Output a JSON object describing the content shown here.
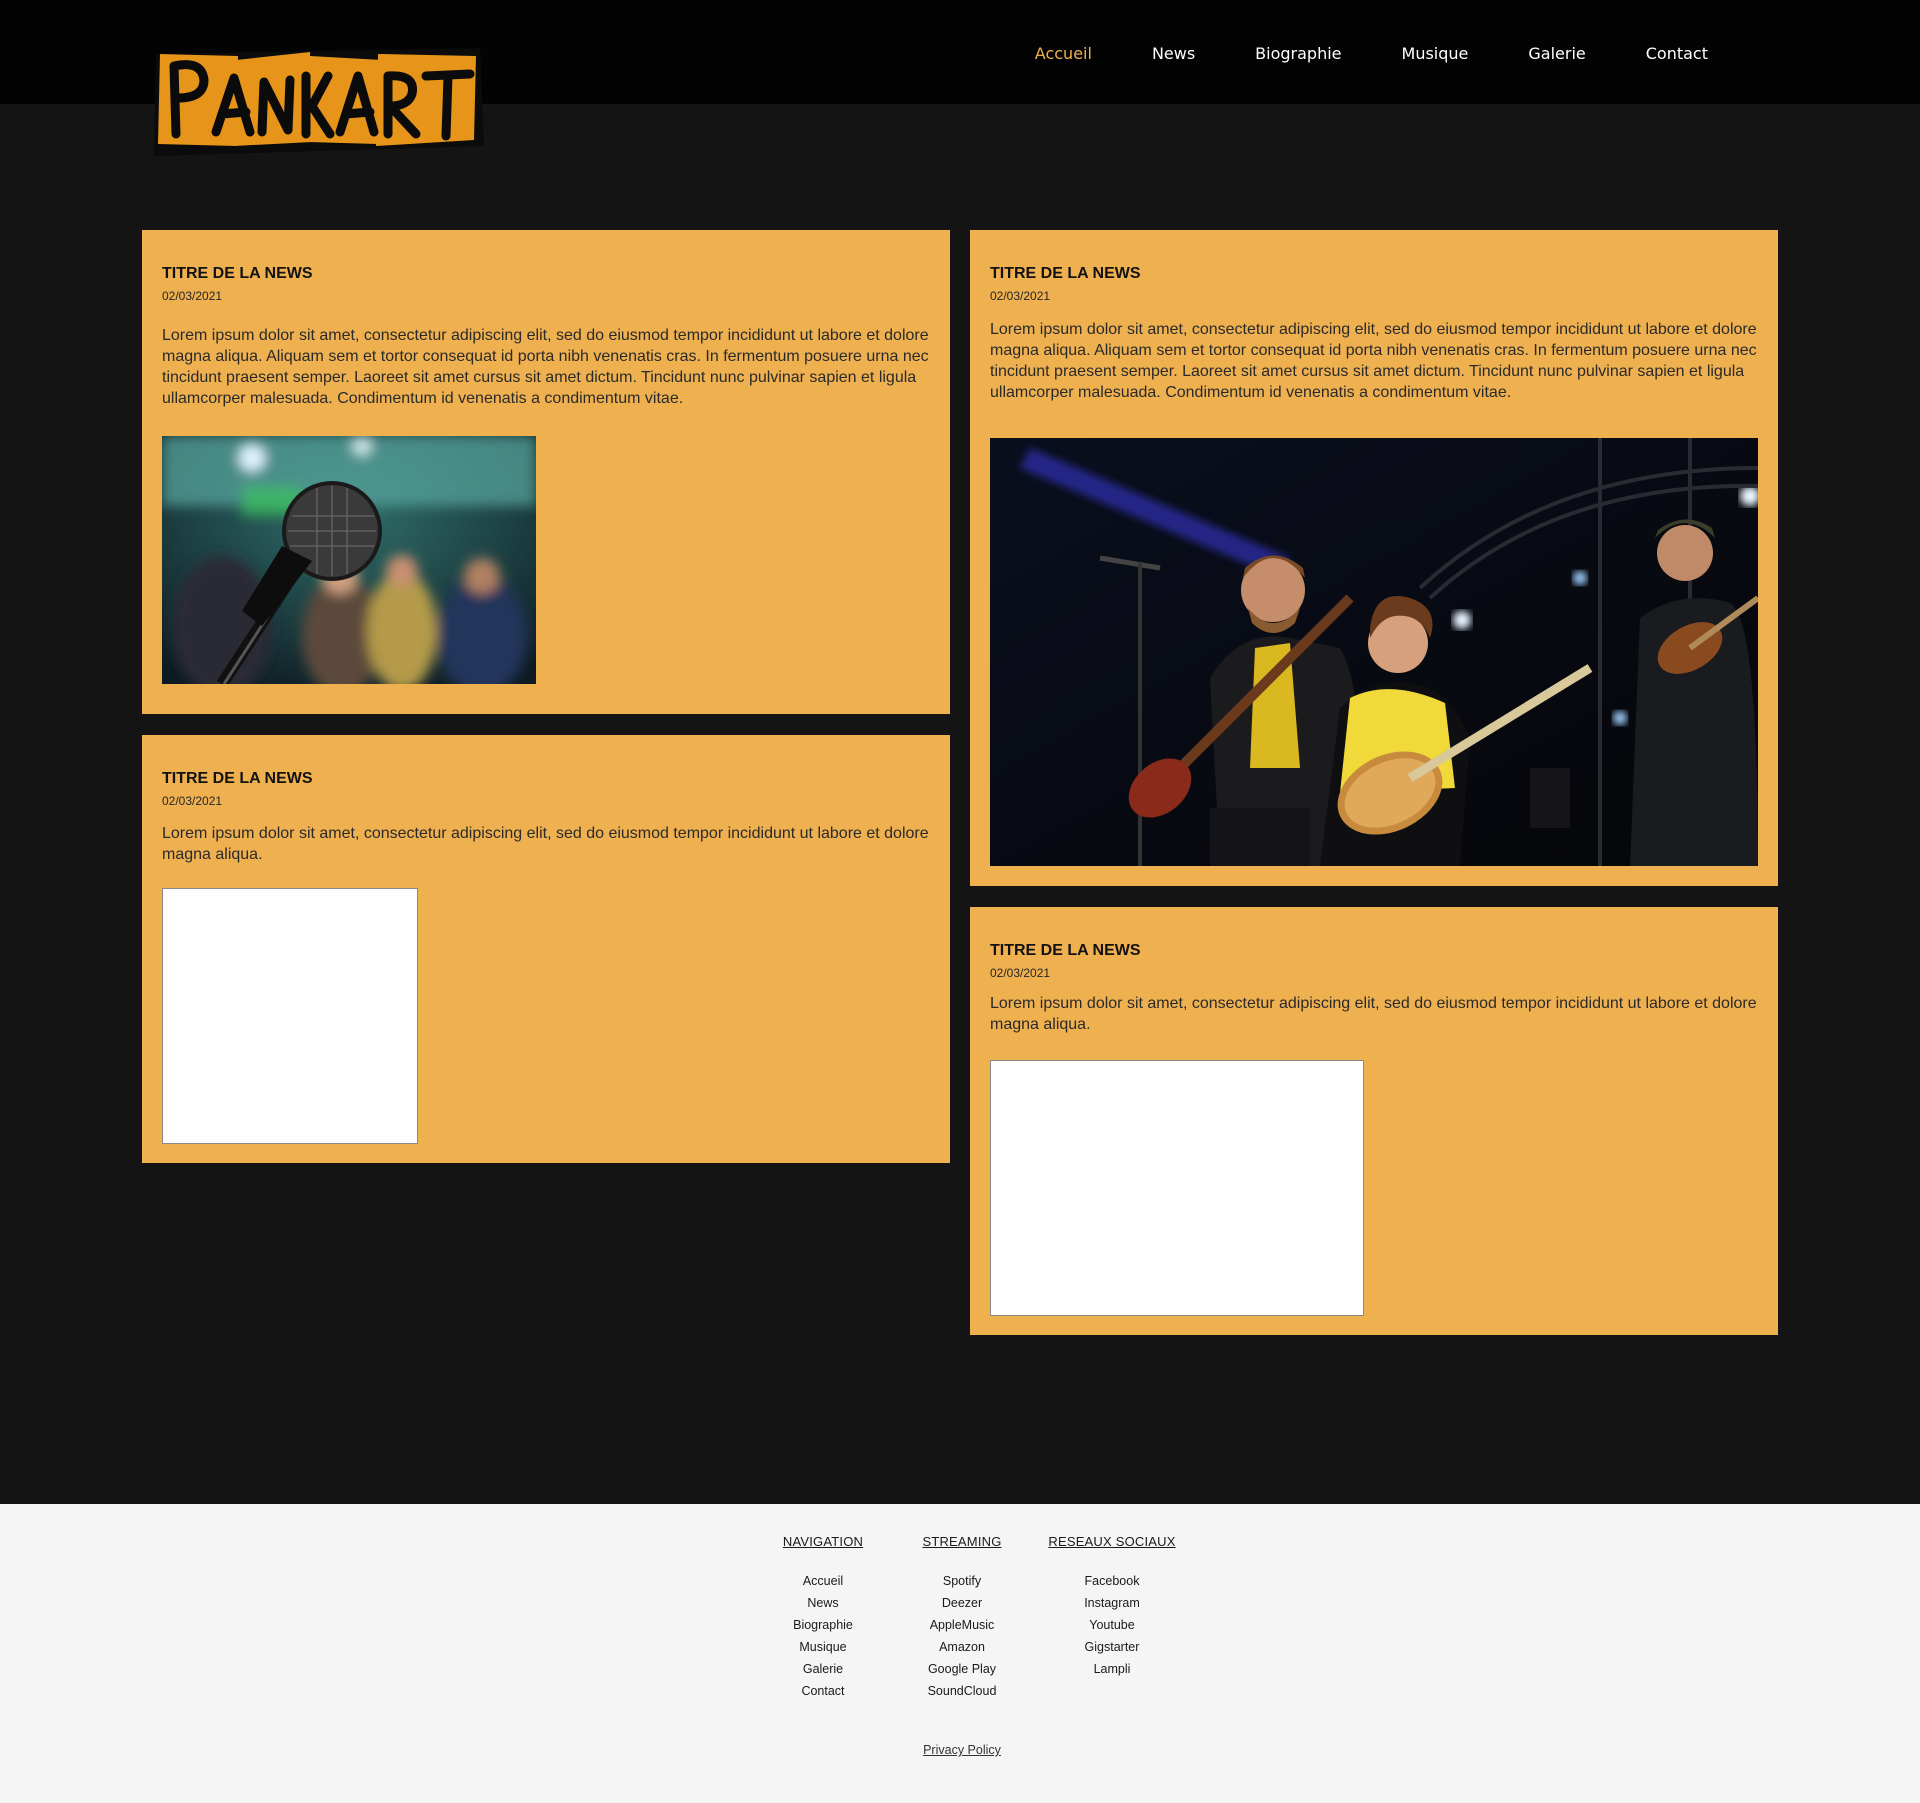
{
  "brand": {
    "logo_text": "PANKART",
    "logo_color": "#e6951a"
  },
  "nav": {
    "items": [
      "Accueil",
      "News",
      "Biographie",
      "Musique",
      "Galerie",
      "Contact"
    ],
    "active": "Accueil",
    "active_color": "#efb050"
  },
  "colors": {
    "card_bg": "#efb050",
    "page_bg": "#141414",
    "header_bg": "#030303",
    "footer_bg": "#f5f5f5"
  },
  "news": [
    {
      "title": "TITRE DE LA NEWS",
      "date": "02/03/2021",
      "text": "Lorem ipsum dolor sit amet, consectetur adipiscing elit, sed do eiusmod tempor incididunt ut labore et dolore magna aliqua. Aliquam sem et tortor consequat id porta nibh venenatis cras. In fermentum posuere urna nec tincidunt praesent semper. Laoreet sit amet cursus sit amet dictum. Tincidunt nunc pulvinar sapien et ligula ullamcorper malesuada. Condimentum id venenatis a condimentum vitae.",
      "media": "microphone-photo"
    },
    {
      "title": "TITRE DE LA NEWS",
      "date": "02/03/2021",
      "text": "Lorem ipsum dolor sit amet, consectetur adipiscing elit, sed do eiusmod tempor incididunt ut labore et dolore magna aliqua. Aliquam sem et tortor consequat id porta nibh venenatis cras. In fermentum posuere urna nec tincidunt praesent semper. Laoreet sit amet cursus sit amet dictum. Tincidunt nunc pulvinar sapien et ligula ullamcorper malesuada. Condimentum id venenatis a condimentum vitae.",
      "media": "band-on-stage-photo"
    },
    {
      "title": "TITRE DE LA NEWS",
      "date": "02/03/2021",
      "text": "Lorem ipsum dolor sit amet, consectetur adipiscing elit, sed do eiusmod tempor incididunt ut labore et dolore magna aliqua.",
      "media": "blank-embed"
    },
    {
      "title": "TITRE DE LA NEWS",
      "date": "02/03/2021",
      "text": "Lorem ipsum dolor sit amet, consectetur adipiscing elit, sed do eiusmod tempor incididunt ut labore et dolore magna aliqua.",
      "media": "blank-embed"
    }
  ],
  "footer": {
    "navigation": {
      "heading": "NAVIGATION",
      "links": [
        "Accueil",
        "News",
        "Biographie",
        "Musique",
        "Galerie",
        "Contact"
      ]
    },
    "streaming": {
      "heading": "STREAMING",
      "links": [
        "Spotify",
        "Deezer",
        "AppleMusic",
        "Amazon",
        "Google Play",
        "SoundCloud"
      ]
    },
    "social": {
      "heading": "RESEAUX SOCIAUX",
      "links": [
        "Facebook",
        "Instagram",
        "Youtube",
        "Gigstarter",
        "Lampli"
      ]
    },
    "privacy": "Privacy Policy"
  }
}
